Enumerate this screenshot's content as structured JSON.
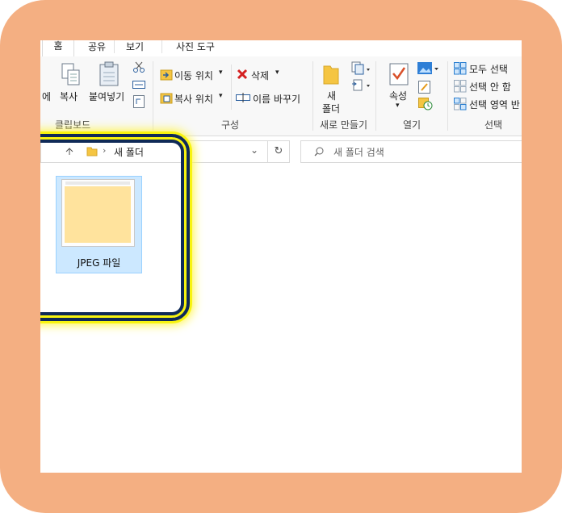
{
  "tabs": [
    "홈",
    "공유",
    "보기",
    "사진 도구"
  ],
  "clipboard": {
    "partial_label": "에",
    "copy": "복사",
    "paste": "붙여넣기",
    "group": "클립보드"
  },
  "organize": {
    "move_to": "이동 위치",
    "copy_to": "복사 위치",
    "delete": "삭제",
    "rename": "이름 바꾸기",
    "group": "구성"
  },
  "new": {
    "folder_line1": "새",
    "folder_line2": "폴더",
    "group": "새로 만들기"
  },
  "open": {
    "properties": "속성",
    "group": "열기"
  },
  "select": {
    "select_all": "모두 선택",
    "select_none": "선택 안 함",
    "invert": "선택 영역 반",
    "group": "선택"
  },
  "address": {
    "path": "새 폴더"
  },
  "search": {
    "placeholder": "새 폴더 검색"
  },
  "file": {
    "name": "JPEG 파일"
  },
  "colors": {
    "frame": "#f4af82",
    "selection": "#cce8ff",
    "highlight_yellow": "#f8f40f",
    "highlight_navy": "#0f2a57"
  }
}
